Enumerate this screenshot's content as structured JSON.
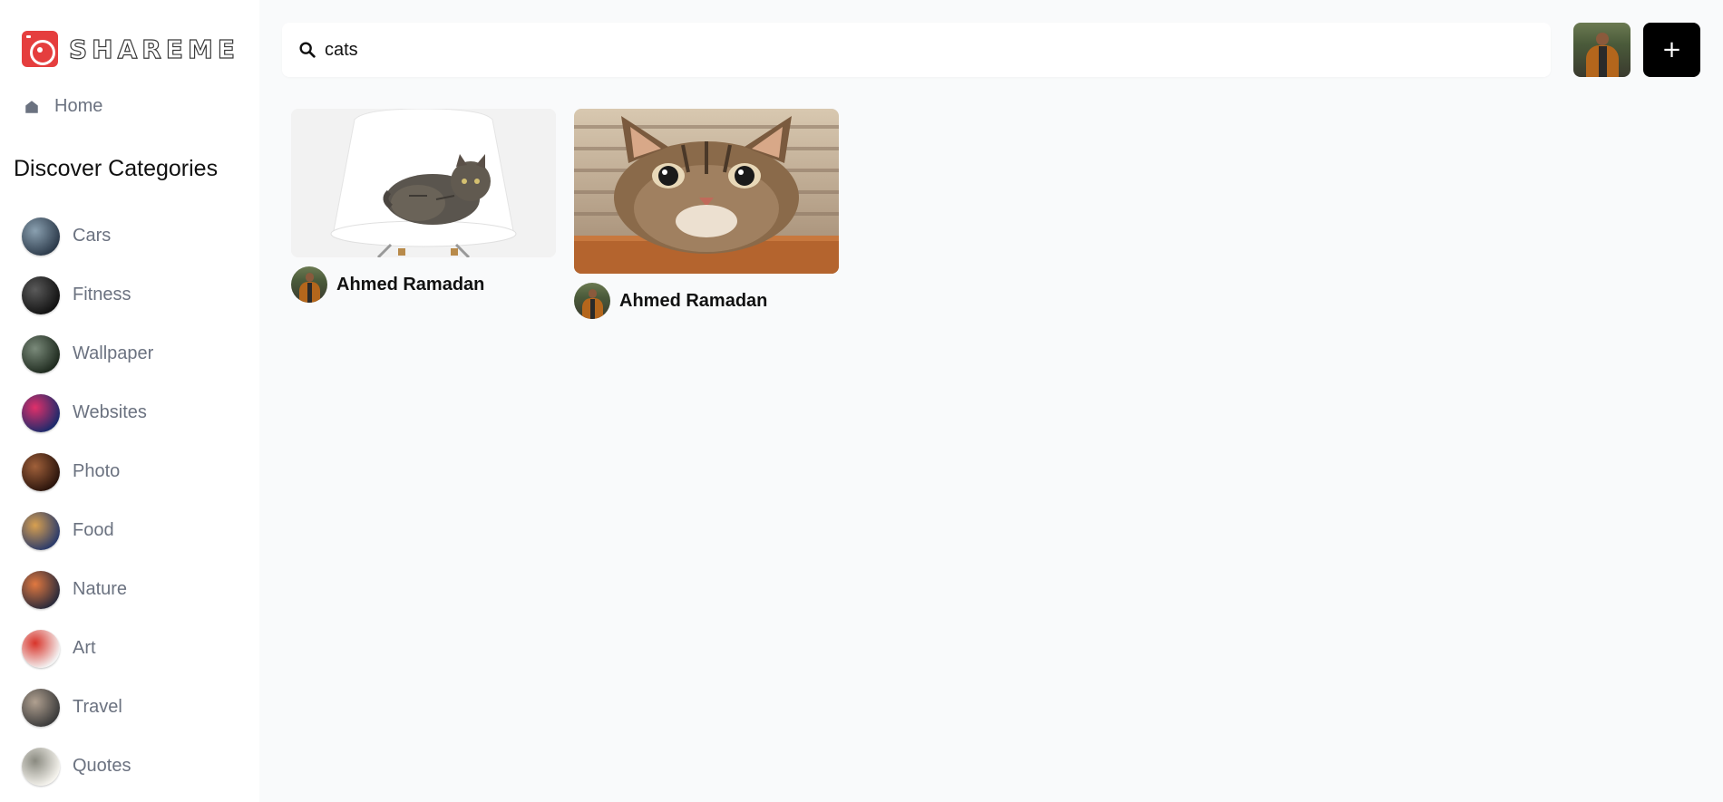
{
  "app": {
    "logo_text": "SHAREME"
  },
  "sidebar": {
    "home_label": "Home",
    "discover_title": "Discover Categories",
    "categories": [
      {
        "label": "Cars",
        "color_a": "#2c3a4a",
        "color_b": "#8aa0b0"
      },
      {
        "label": "Fitness",
        "color_a": "#111111",
        "color_b": "#5a5a5a"
      },
      {
        "label": "Wallpaper",
        "color_a": "#1e2a1e",
        "color_b": "#7a8a7a"
      },
      {
        "label": "Websites",
        "color_a": "#1b2a6b",
        "color_b": "#e0306a"
      },
      {
        "label": "Photo",
        "color_a": "#2a140c",
        "color_b": "#a0603a"
      },
      {
        "label": "Food",
        "color_a": "#2a3a6a",
        "color_b": "#d8a050"
      },
      {
        "label": "Nature",
        "color_a": "#2a2a3a",
        "color_b": "#e07840"
      },
      {
        "label": "Art",
        "color_a": "#f4f4f4",
        "color_b": "#d8342a"
      },
      {
        "label": "Travel",
        "color_a": "#3a3a3a",
        "color_b": "#b0a090"
      },
      {
        "label": "Quotes",
        "color_a": "#f6f4ee",
        "color_b": "#8a8a80"
      }
    ]
  },
  "search": {
    "value": "cats",
    "placeholder": "Search"
  },
  "header": {
    "add_label": "+"
  },
  "pins": [
    {
      "author": "Ahmed Ramadan"
    },
    {
      "author": "Ahmed Ramadan"
    }
  ]
}
